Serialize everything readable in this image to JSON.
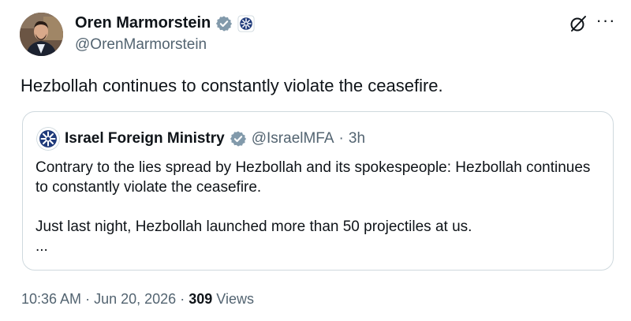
{
  "author": {
    "name": "Oren Marmorstein",
    "handle": "@OrenMarmorstein",
    "avatar_icon": "profile-photo"
  },
  "tweet": {
    "text": "Hezbollah continues to constantly violate the ceasefire."
  },
  "quoted_tweet": {
    "author_name": "Israel Foreign Ministry",
    "handle": "@IsraelMFA",
    "separator": "·",
    "time_ago": "3h",
    "paragraph_1": "Contrary to the lies spread by Hezbollah and its spokespeople: Hezbollah continues to constantly violate the ceasefire.",
    "paragraph_2": "Just last night, Hezbollah launched more than 50 projectiles at us.",
    "ellipsis": "..."
  },
  "meta": {
    "time": "10:36 AM",
    "date": "Jun 20, 2026",
    "views_count": "309",
    "views_label": "Views",
    "separator": "·"
  },
  "icons": {
    "verified_badge_color": "#829aab",
    "org_logo_color": "#1f3a7a"
  }
}
